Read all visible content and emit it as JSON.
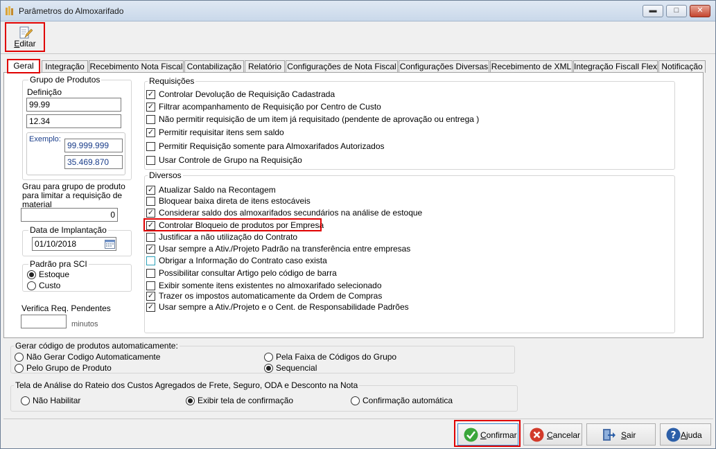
{
  "window": {
    "title": "Parâmetros do Almoxarifado",
    "min": "▬",
    "max": "□",
    "close": "✕"
  },
  "toolbar": {
    "edit_label": "Editar"
  },
  "tabs": [
    "Geral",
    "Integração",
    "Recebimento Nota Fiscal",
    "Contabilização",
    "Relatório",
    "Configurações de Nota Fiscal",
    "Configurações Diversas",
    "Recebimento de XML",
    "Integração Fiscall Flex",
    "Notificação"
  ],
  "grupo_produtos": {
    "title": "Grupo de Produtos",
    "definicao_label": "Definição",
    "def1": "99.99",
    "def2": "12.34",
    "exemplo_label": "Exemplo:",
    "ex1": "99.999.999",
    "ex2": "35.469.870"
  },
  "grau": {
    "label": "Grau para grupo de produto para limitar a requisição de material",
    "value": "0"
  },
  "data_implantacao": {
    "title": "Data de Implantação",
    "value": "01/10/2018"
  },
  "padrao_sci": {
    "title": "Padrão pra SCI",
    "options": [
      "Estoque",
      "Custo"
    ],
    "selected": 0
  },
  "verifica": {
    "label": "Verifica Req. Pendentes",
    "value": "",
    "unit": "minutos"
  },
  "requisicoes": {
    "title": "Requisições",
    "items": [
      {
        "label": "Controlar Devolução de Requisição Cadastrada",
        "checked": true
      },
      {
        "label": "Filtrar acompanhamento de Requisição por Centro de Custo",
        "checked": true
      },
      {
        "label": "Não permitir requisição de um item já requisitado (pendente de aprovação ou entrega )",
        "checked": false
      },
      {
        "label": "Permitir requisitar itens sem saldo",
        "checked": true
      },
      {
        "label": "Permitir Requisição somente para Almoxarifados Autorizados",
        "checked": false
      },
      {
        "label": "Usar Controle de Grupo na Requisição",
        "checked": false
      }
    ]
  },
  "diversos": {
    "title": "Diversos",
    "items": [
      {
        "label": "Atualizar Saldo na Recontagem",
        "checked": true
      },
      {
        "label": "Bloquear baixa direta de itens estocáveis",
        "checked": false
      },
      {
        "label": "Considerar saldo dos almoxarifados secundários na análise de estoque",
        "checked": true
      },
      {
        "label": "Controlar Bloqueio de produtos por Empresa",
        "checked": true
      },
      {
        "label": "Justificar a não utilização do Contrato",
        "checked": false
      },
      {
        "label": "Usar sempre a Ativ./Projeto Padrão na transferência entre empresas",
        "checked": true
      },
      {
        "label": "Obrigar a Informação do Contrato caso exista",
        "checked": false
      },
      {
        "label": "Possibilitar consultar Artigo pelo código de barra",
        "checked": false
      },
      {
        "label": "Exibir somente itens existentes no almoxarifado selecionado",
        "checked": false
      },
      {
        "label": "Trazer os impostos automaticamente da Ordem de Compras",
        "checked": true
      },
      {
        "label": "Usar sempre a Ativ./Projeto e o Cent. de Responsabilidade Padrões",
        "checked": true
      }
    ]
  },
  "gerar_codigo": {
    "title": "Gerar código de produtos automaticamente:",
    "options": [
      "Não Gerar Codigo Automaticamente",
      "Pelo Grupo de Produto",
      "Pela Faixa de Códigos do Grupo",
      "Sequencial"
    ],
    "selected": 3
  },
  "rateio": {
    "title": "Tela de Análise do Rateio dos Custos Agregados de Frete, Seguro, ODA e Desconto na Nota",
    "options": [
      "Não Habilitar",
      "Exibir tela de confirmação",
      "Confirmação automática"
    ],
    "selected": 1
  },
  "buttons": {
    "confirmar": "Confirmar",
    "cancelar": "Cancelar",
    "sair": "Sair",
    "ajuda": "Ajuda"
  },
  "colors": {
    "highlight": "#e00000",
    "confirm": "#3aa63a",
    "cancel": "#d23a2a",
    "help": "#2c5fa8"
  }
}
